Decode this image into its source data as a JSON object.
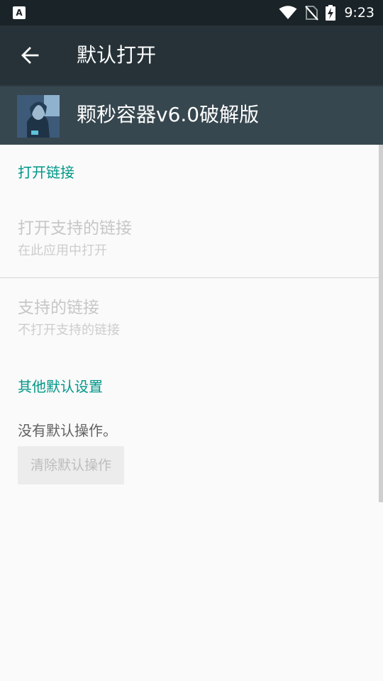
{
  "status_bar": {
    "notification_icon_label": "A",
    "time": "9:23",
    "icons": [
      "wifi-icon",
      "no-sim-icon",
      "battery-charging-icon"
    ]
  },
  "app_bar": {
    "back_icon": "arrow-left-icon",
    "title": "默认打开"
  },
  "app_header": {
    "name": "颗秒容器v6.0破解版"
  },
  "sections": {
    "open_links": {
      "header": "打开链接",
      "pref_open_supported": {
        "title": "打开支持的链接",
        "summary": "在此应用中打开"
      },
      "pref_supported_links": {
        "title": "支持的链接",
        "summary": "不打开支持的链接"
      }
    },
    "other_defaults": {
      "header": "其他默认设置",
      "message": "没有默认操作。",
      "clear_button": "清除默认操作"
    }
  },
  "colors": {
    "status_bar": "#1a2327",
    "app_bar": "#263238",
    "app_header": "#37474f",
    "accent": "#009688",
    "background": "#fafafa"
  }
}
